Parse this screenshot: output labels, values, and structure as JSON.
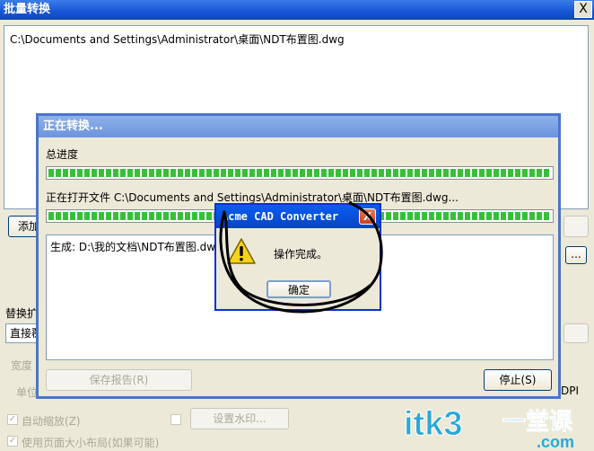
{
  "background_window": {
    "title": "批量转换",
    "close_glyph": "X",
    "file_list": [
      "C:\\Documents and Settings\\Administrator\\桌面\\NDT布置图.dwg"
    ],
    "add_button_label": "添加",
    "browse_button_label": "...",
    "replace_label": "替换扩",
    "replace_value": "直接覆",
    "width_label": "宽度",
    "unit_label": "单位",
    "dpi_label": "DPI",
    "auto_zoom_label": "自动缩放(Z)",
    "page_layout_label": "使用页面大小布局(如果可能)",
    "watermark_button_label": "设置水印..."
  },
  "progress_dialog": {
    "title": "正在转换...",
    "overall_label": "总进度",
    "overall_progress": 1.0,
    "current_file_label": "正在打开文件 C:\\Documents and Settings\\Administrator\\桌面\\NDT布置图.dwg...",
    "file_progress": 1.0,
    "log_lines": [
      "生成: D:\\我的文档\\NDT布置图.dwg"
    ],
    "save_report_label": "保存报告(R)",
    "stop_label": "停止(S)"
  },
  "message_box": {
    "title": "Acme CAD Converter",
    "close_glyph": "X",
    "icon": "warning-icon",
    "message": "操作完成。",
    "ok_label": "确定"
  },
  "watermark": {
    "brand": "itk3",
    "cn_text": "一堂课",
    "domain": ".com",
    "colors": {
      "brand": "#2aa8d8",
      "accent": "#ffffff"
    }
  }
}
